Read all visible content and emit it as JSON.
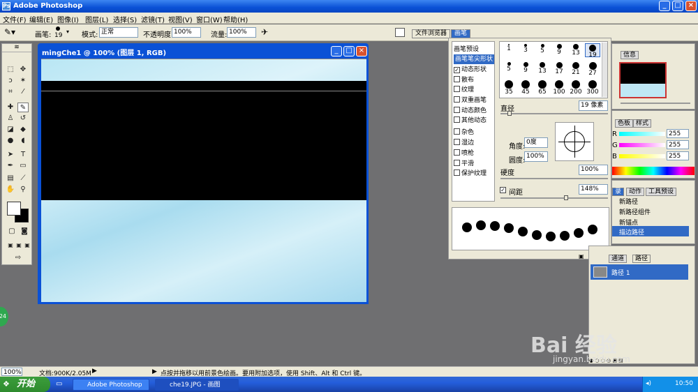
{
  "window": {
    "title": "Adobe Photoshop",
    "minimize": "_",
    "maximize": "□",
    "close": "×"
  },
  "menu": [
    "文件(F)",
    "编辑(E)",
    "图像(I)",
    "图层(L)",
    "选择(S)",
    "滤镜(T)",
    "视图(V)",
    "窗口(W)",
    "帮助(H)"
  ],
  "options": {
    "brush_label": "画笔:",
    "brush_size": "19",
    "mode_label": "模式:",
    "mode_value": "正常",
    "opacity_label": "不透明度:",
    "opacity_value": "100%",
    "flow_label": "流量:",
    "flow_value": "100%"
  },
  "palette_tabs": {
    "file_browser": "文件浏览器",
    "brushes": "画笔"
  },
  "document": {
    "title": "mingChe1 @ 100% (图层 1, RGB)"
  },
  "brush_panel": {
    "options": [
      {
        "label": "画笔预设",
        "checkbox": false,
        "checked": false,
        "selected": false
      },
      {
        "label": "画笔笔尖形状",
        "checkbox": false,
        "checked": false,
        "selected": true
      },
      {
        "label": "动态形状",
        "checkbox": true,
        "checked": true,
        "selected": false
      },
      {
        "label": "散布",
        "checkbox": true,
        "checked": false,
        "selected": false
      },
      {
        "label": "纹理",
        "checkbox": true,
        "checked": false,
        "selected": false
      },
      {
        "label": "双重画笔",
        "checkbox": true,
        "checked": false,
        "selected": false
      },
      {
        "label": "动态颜色",
        "checkbox": true,
        "checked": false,
        "selected": false
      },
      {
        "label": "其他动态",
        "checkbox": true,
        "checked": false,
        "selected": false
      },
      {
        "label": "杂色",
        "checkbox": true,
        "checked": false,
        "selected": false
      },
      {
        "label": "湿边",
        "checkbox": true,
        "checked": false,
        "selected": false
      },
      {
        "label": "喷枪",
        "checkbox": true,
        "checked": false,
        "selected": false
      },
      {
        "label": "平滑",
        "checkbox": true,
        "checked": false,
        "selected": false
      },
      {
        "label": "保护纹理",
        "checkbox": true,
        "checked": false,
        "selected": false
      }
    ],
    "tip_sizes": [
      [
        "1",
        "3",
        "5",
        "9",
        "13",
        "19"
      ],
      [
        "5",
        "9",
        "13",
        "17",
        "21",
        "27"
      ],
      [
        "35",
        "45",
        "65",
        "100",
        "200",
        "300"
      ]
    ],
    "diameter_label": "直径",
    "diameter_value": "19 像素",
    "angle_label": "角度:",
    "angle_value": "0度",
    "roundness_label": "圆度:",
    "roundness_value": "100%",
    "hardness_label": "硬度",
    "hardness_value": "100%",
    "spacing_label": "间距",
    "spacing_value": "148%"
  },
  "navigator": {
    "tab": "信息"
  },
  "color": {
    "tabs": [
      "色板",
      "样式"
    ],
    "r": "255",
    "g": "255",
    "b": "255",
    "r_label": "R",
    "g_label": "G",
    "b_label": "B"
  },
  "history": {
    "tabs": [
      "录",
      "动作",
      "工具预设"
    ],
    "items": [
      "新路径",
      "新路径组件",
      "新锚点",
      "描边路径"
    ]
  },
  "paths": {
    "tabs": [
      "通道",
      "路径"
    ],
    "items": [
      "路径 1"
    ]
  },
  "status": {
    "zoom": "100%",
    "doc": "文档:900K/2.05M",
    "hint": "点按并拖移以用前景色绘画。要用附加选项，使用 Shift、Alt 和 Ctrl 键。"
  },
  "green_badge": "24",
  "taskbar": {
    "start": "开始",
    "tasks": [
      "Adobe Photoshop",
      "che19.JPG - 画图"
    ],
    "time": "10:50"
  },
  "watermark": {
    "logo": "Bai 经验",
    "url": "jingyan.baidu.com"
  }
}
